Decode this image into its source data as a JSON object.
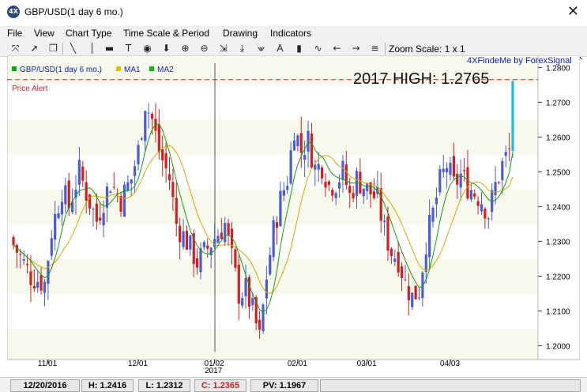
{
  "window": {
    "title": "GBP/USD(1 day  6 mo.)",
    "close_glyph": "✕",
    "app_icon": "4X"
  },
  "menu": {
    "items": [
      "File",
      "View",
      "Chart Type",
      "Time Scale & Period",
      "Drawing",
      "Indicators"
    ],
    "window_controls": [
      "▭",
      "✕"
    ]
  },
  "toolbar": {
    "zoom_label": "Zoom Scale: 1 x 1",
    "icons": [
      "crosshair-icon",
      "cursor-icon",
      "copy-icon",
      "trendline-icon",
      "vertical-line-icon",
      "horizontal-line-icon",
      "text-icon",
      "target-icon",
      "down-arrow-icon",
      "zoom-in-icon",
      "zoom-out-icon",
      "fit-icon",
      "bottom-align-icon",
      "indicator-a-icon",
      "bar-chart-icon",
      "wave-icon",
      "left-arrow-icon",
      "right-arrow-icon",
      "list-icon"
    ]
  },
  "chart": {
    "brand": "4XFindeMe by ForexSignal",
    "legend": [
      {
        "label": "GBP/USD(1 day  6 mo.)",
        "color": "#00b000"
      },
      {
        "label": "MA1",
        "color": "#e0c000"
      },
      {
        "label": "MA2",
        "color": "#00c000"
      }
    ],
    "price_alert_label": "Price Alert",
    "headline": "2017 HIGH: 1.2765",
    "year_label": "2017",
    "colors": {
      "up": "#4a5cd6",
      "down": "#d02020",
      "ma1": "#d8a800",
      "ma2": "#10a010",
      "last": "#20b8e8",
      "alert": "#d02020"
    }
  },
  "chart_data": {
    "type": "candlestick",
    "y_ticks": [
      "1.2800",
      "1.2700",
      "1.2600",
      "1.2500",
      "1.2400",
      "1.2300",
      "1.2200",
      "1.2100",
      "1.2000"
    ],
    "ylim": [
      1.196,
      1.2835
    ],
    "x_ticks": [
      "11/01",
      "12/01",
      "01/02",
      "02/01",
      "03/01",
      "04/03"
    ],
    "price_alert": 1.2765,
    "anchors": [
      [
        0,
        1.229
      ],
      [
        5,
        1.22
      ],
      [
        9,
        1.218
      ],
      [
        11,
        1.233
      ],
      [
        14,
        1.245
      ],
      [
        16,
        1.24
      ],
      [
        19,
        1.25
      ],
      [
        21,
        1.244
      ],
      [
        24,
        1.236
      ],
      [
        26,
        1.242
      ],
      [
        28,
        1.247
      ],
      [
        31,
        1.242
      ],
      [
        34,
        1.248
      ],
      [
        36,
        1.256
      ],
      [
        38,
        1.27
      ],
      [
        40,
        1.265
      ],
      [
        42,
        1.256
      ],
      [
        45,
        1.248
      ],
      [
        47,
        1.235
      ],
      [
        50,
        1.23
      ],
      [
        53,
        1.224
      ],
      [
        56,
        1.228
      ],
      [
        58,
        1.231
      ],
      [
        61,
        1.235
      ],
      [
        63,
        1.225
      ],
      [
        65,
        1.215
      ],
      [
        67,
        1.216
      ],
      [
        69,
        1.21
      ],
      [
        71,
        1.202
      ],
      [
        73,
        1.22
      ],
      [
        75,
        1.233
      ],
      [
        77,
        1.242
      ],
      [
        79,
        1.248
      ],
      [
        81,
        1.263
      ],
      [
        83,
        1.256
      ],
      [
        85,
        1.259
      ],
      [
        87,
        1.251
      ],
      [
        89,
        1.252
      ],
      [
        91,
        1.246
      ],
      [
        93,
        1.247
      ],
      [
        95,
        1.25
      ],
      [
        97,
        1.243
      ],
      [
        99,
        1.248
      ],
      [
        101,
        1.246
      ],
      [
        103,
        1.244
      ],
      [
        105,
        1.242
      ],
      [
        107,
        1.233
      ],
      [
        109,
        1.227
      ],
      [
        111,
        1.225
      ],
      [
        113,
        1.218
      ],
      [
        115,
        1.214
      ],
      [
        117,
        1.216
      ],
      [
        119,
        1.23
      ],
      [
        121,
        1.238
      ],
      [
        123,
        1.247
      ],
      [
        125,
        1.252
      ],
      [
        127,
        1.246
      ],
      [
        129,
        1.249
      ],
      [
        131,
        1.246
      ],
      [
        133,
        1.244
      ],
      [
        135,
        1.242
      ],
      [
        137,
        1.238
      ],
      [
        139,
        1.246
      ],
      [
        141,
        1.252
      ],
      [
        143,
        1.256
      ],
      [
        144,
        1.2765
      ]
    ]
  },
  "status": {
    "date": "12/20/2016",
    "high": "H: 1.2416",
    "low": "L: 1.2312",
    "close": "C: 1.2365",
    "pv": "PV: 1.1967"
  }
}
